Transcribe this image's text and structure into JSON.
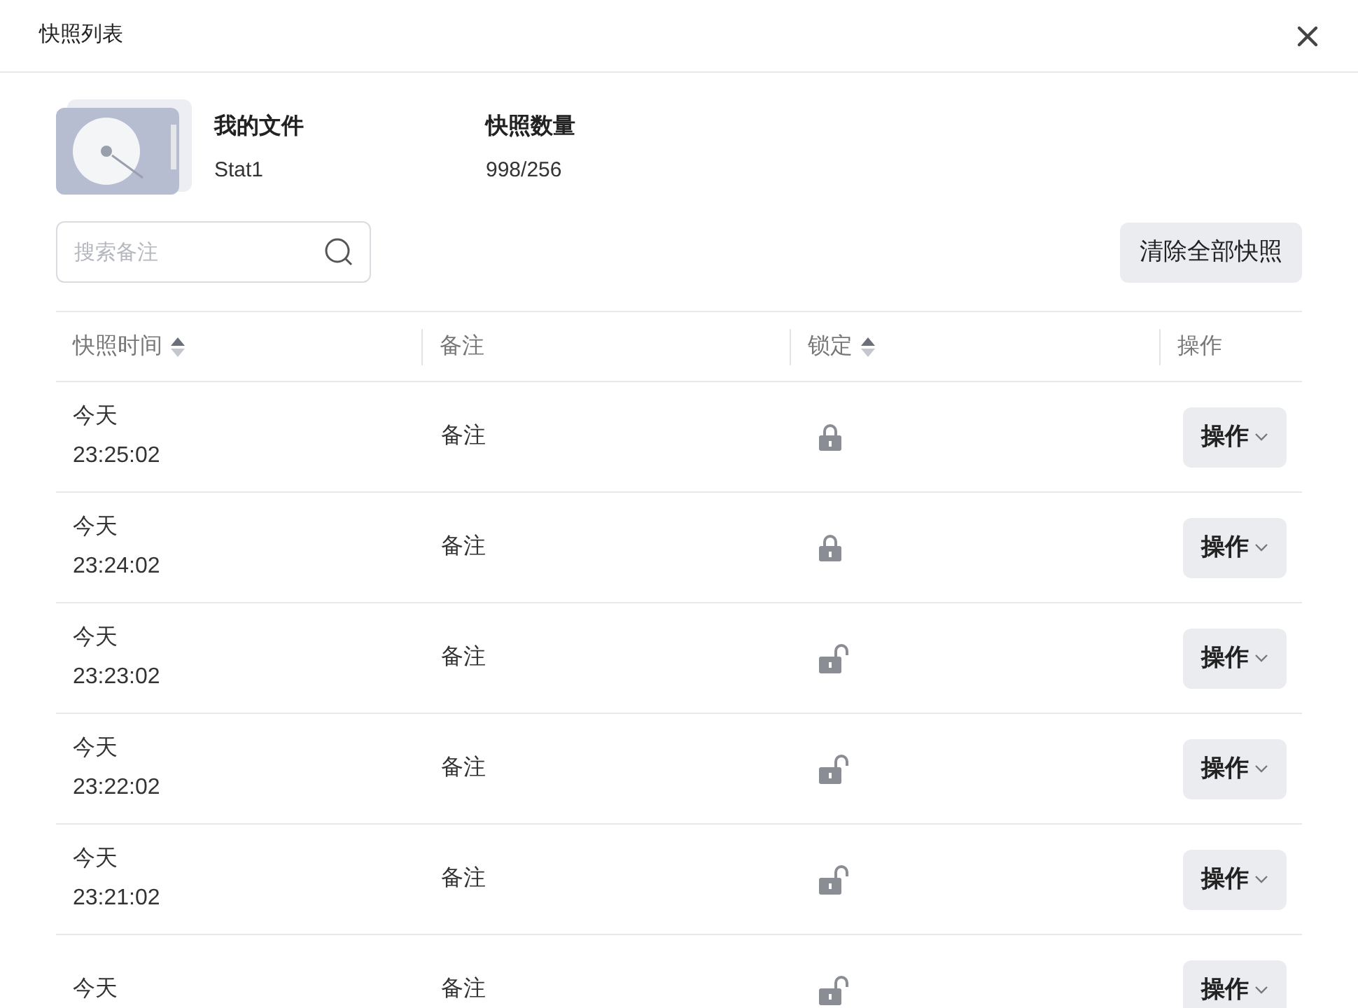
{
  "window": {
    "title": "快照列表"
  },
  "file": {
    "name_label": "我的文件",
    "name": "Stat1",
    "count_label": "快照数量",
    "count": "998/256"
  },
  "search": {
    "placeholder": "搜索备注"
  },
  "clear_button": "清除全部快照",
  "table": {
    "columns": [
      {
        "label": "快照时间",
        "sortable": true
      },
      {
        "label": "备注",
        "sortable": false
      },
      {
        "label": "锁定",
        "sortable": true
      },
      {
        "label": "操作",
        "sortable": false
      }
    ],
    "rows": [
      {
        "date": "今天",
        "time": "23:25:02",
        "note": "备注",
        "locked": true,
        "action": "操作"
      },
      {
        "date": "今天",
        "time": "23:24:02",
        "note": "备注",
        "locked": true,
        "action": "操作"
      },
      {
        "date": "今天",
        "time": "23:23:02",
        "note": "备注",
        "locked": false,
        "action": "操作"
      },
      {
        "date": "今天",
        "time": "23:22:02",
        "note": "备注",
        "locked": false,
        "action": "操作"
      },
      {
        "date": "今天",
        "time": "23:21:02",
        "note": "备注",
        "locked": false,
        "action": "操作"
      },
      {
        "date": "今天",
        "note": "备注",
        "locked": false,
        "action": "操作"
      }
    ]
  }
}
